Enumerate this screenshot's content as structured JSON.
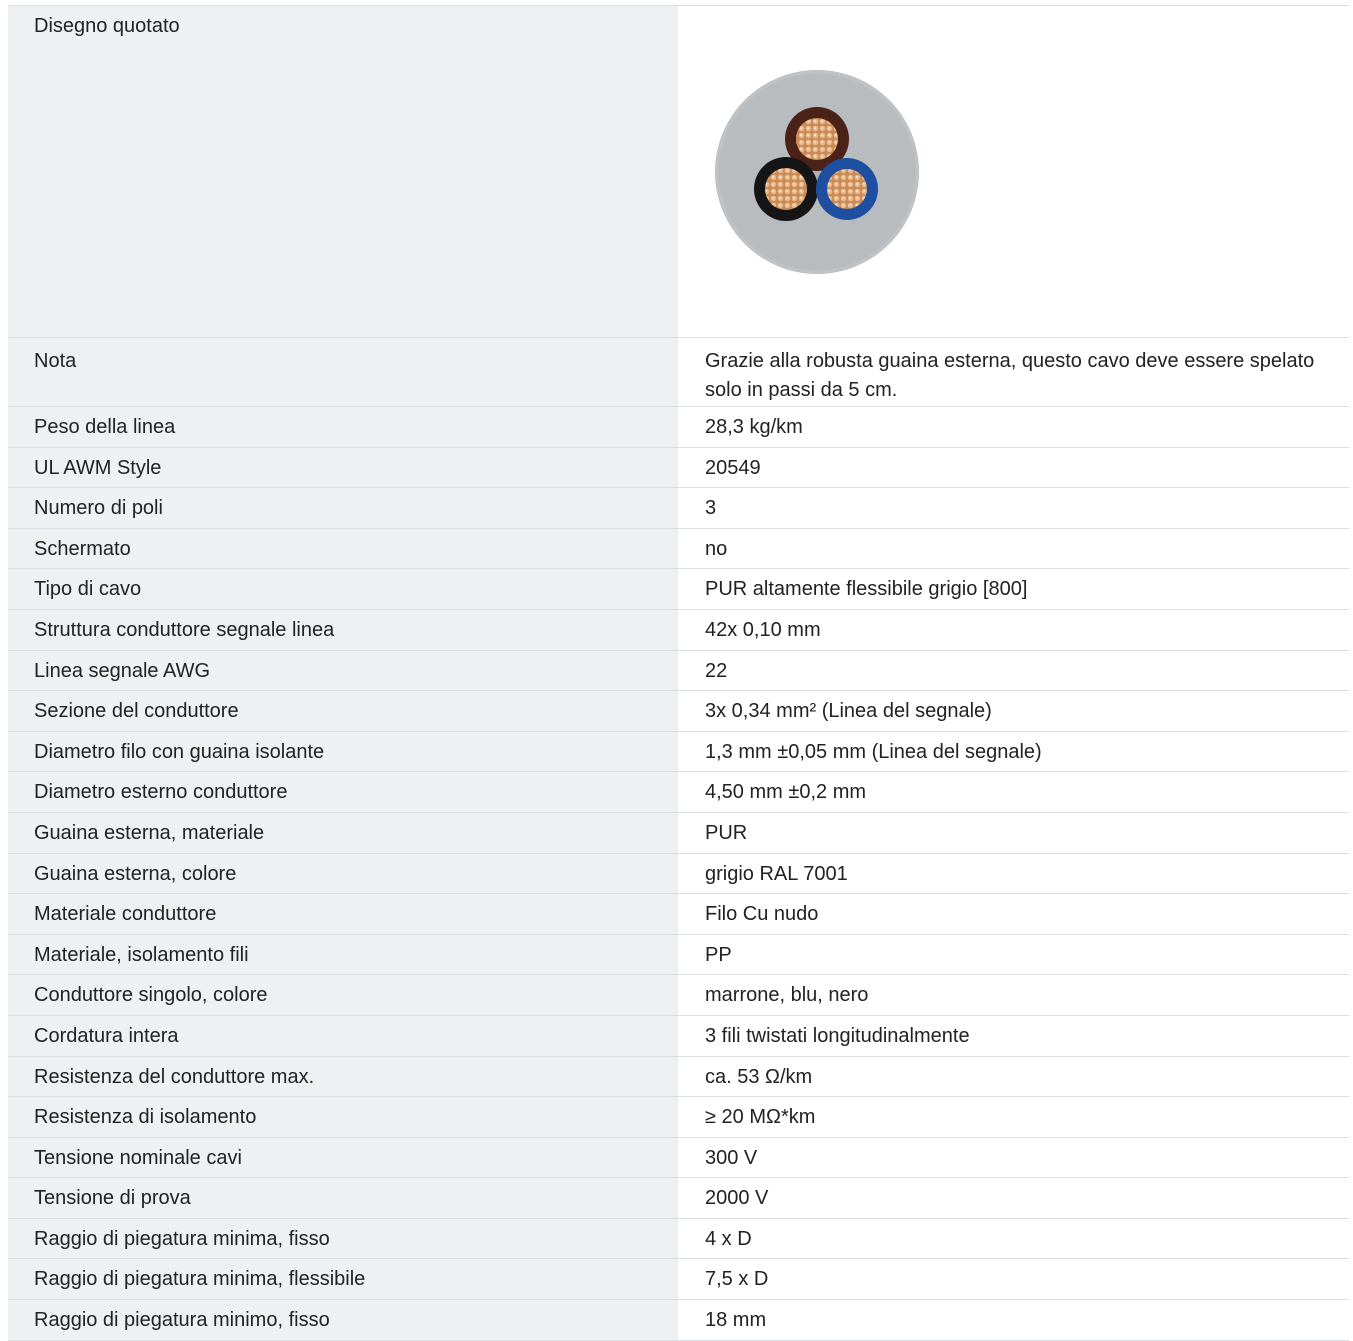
{
  "drawing": {
    "label": "Disegno quotato",
    "colors": {
      "sheath": "#b9bcbf",
      "core_brown": "#4a2218",
      "core_blue": "#1f4fa0",
      "core_black": "#151515",
      "copper": "#c98a55"
    }
  },
  "rows": [
    {
      "label": "Nota",
      "value": "Grazie alla robusta guaina esterna, questo cavo deve essere spelato solo in passi da 5 cm."
    },
    {
      "label": "Peso della linea",
      "value": "28,3 kg/km"
    },
    {
      "label": "UL AWM Style",
      "value": "20549"
    },
    {
      "label": "Numero di poli",
      "value": "3"
    },
    {
      "label": "Schermato",
      "value": "no"
    },
    {
      "label": "Tipo di cavo",
      "value": "PUR altamente flessibile grigio [800]"
    },
    {
      "label": "Struttura conduttore segnale linea",
      "value": "42x 0,10 mm"
    },
    {
      "label": "Linea segnale AWG",
      "value": "22"
    },
    {
      "label": "Sezione del conduttore",
      "value": "3x 0,34 mm² (Linea del segnale)"
    },
    {
      "label": "Diametro filo con guaina isolante",
      "value": "1,3 mm ±0,05 mm (Linea del segnale)"
    },
    {
      "label": "Diametro esterno conduttore",
      "value": "4,50 mm ±0,2 mm"
    },
    {
      "label": "Guaina esterna, materiale",
      "value": "PUR"
    },
    {
      "label": "Guaina esterna, colore",
      "value": "grigio RAL 7001"
    },
    {
      "label": "Materiale conduttore",
      "value": "Filo Cu nudo"
    },
    {
      "label": "Materiale, isolamento fili",
      "value": "PP"
    },
    {
      "label": "Conduttore singolo, colore",
      "value": "marrone, blu, nero"
    },
    {
      "label": "Cordatura intera",
      "value": "3 fili twistati longitudinalmente"
    },
    {
      "label": "Resistenza del conduttore max.",
      "value": "ca. 53 Ω/km"
    },
    {
      "label": "Resistenza di isolamento",
      "value": "≥ 20 MΩ*km"
    },
    {
      "label": "Tensione nominale cavi",
      "value": "300 V"
    },
    {
      "label": "Tensione di prova",
      "value": "2000 V"
    },
    {
      "label": "Raggio di piegatura minima, fisso",
      "value": "4 x D"
    },
    {
      "label": "Raggio di piegatura minima, flessibile",
      "value": "7,5 x D"
    },
    {
      "label": "Raggio di piegatura minimo, fisso",
      "value": "18 mm"
    }
  ]
}
